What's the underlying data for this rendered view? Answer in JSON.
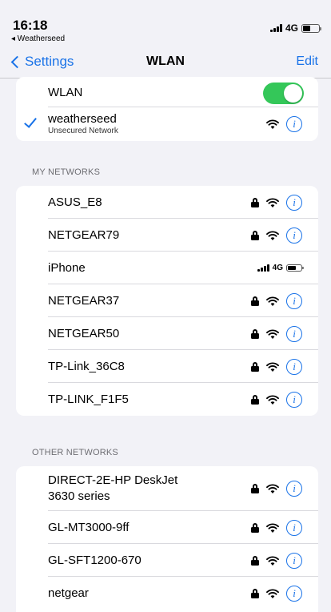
{
  "status_bar": {
    "time": "16:18",
    "back_app": "◂ Weatherseed",
    "network": "4G"
  },
  "nav": {
    "back_label": "Settings",
    "title": "WLAN",
    "edit_label": "Edit"
  },
  "wlan": {
    "label": "WLAN",
    "enabled": true,
    "connected_name": "weatherseed",
    "connected_sub": "Unsecured Network"
  },
  "my_networks": {
    "header": "MY NETWORKS",
    "items": [
      {
        "name": "ASUS_E8"
      },
      {
        "name": "NETGEAR79"
      },
      {
        "name": "iPhone",
        "hotspot_network": "4G"
      },
      {
        "name": "NETGEAR37"
      },
      {
        "name": "NETGEAR50"
      },
      {
        "name": "TP-Link_36C8"
      },
      {
        "name": "TP-LINK_F1F5"
      }
    ]
  },
  "other_networks": {
    "header": "OTHER NETWORKS",
    "items": [
      {
        "name_line1": "DIRECT-2E-HP DeskJet",
        "name_line2": "3630 series"
      },
      {
        "name": "GL-MT3000-9ff"
      },
      {
        "name": "GL-SFT1200-670"
      },
      {
        "name": "netgear"
      }
    ]
  },
  "colors": {
    "accent": "#1a73e8",
    "toggle_on": "#34c759",
    "background": "#f2f2f7"
  }
}
